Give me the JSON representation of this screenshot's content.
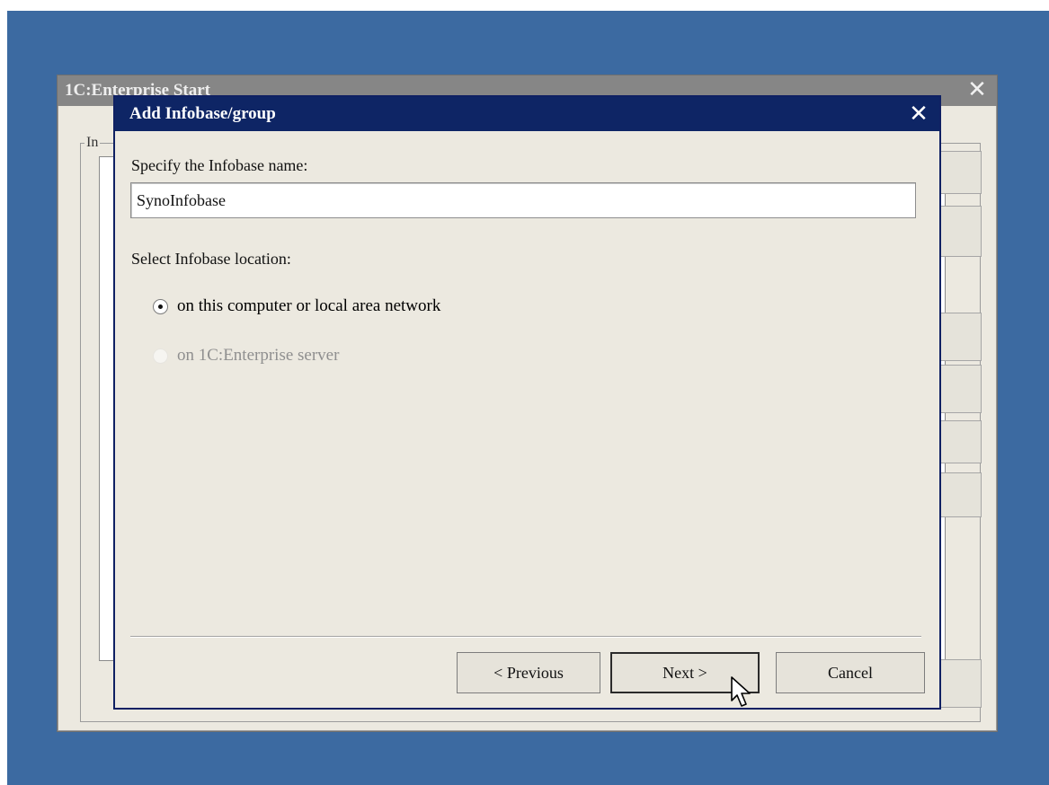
{
  "background_window": {
    "title": "1C:Enterprise Start",
    "group_legend": "In"
  },
  "dialog": {
    "title": "Add Infobase/group",
    "name_label": "Specify the Infobase name:",
    "name_value": "SynoInfobase",
    "location_label": "Select Infobase location:",
    "options": [
      {
        "label": "on this computer or local area network",
        "checked": true,
        "disabled": false
      },
      {
        "label": "on 1C:Enterprise server",
        "checked": false,
        "disabled": true
      }
    ],
    "buttons": {
      "previous": "< Previous",
      "next": "Next >",
      "cancel": "Cancel"
    }
  },
  "colors": {
    "desktop": "#3c6aa1",
    "titlebar_active": "#0e2565",
    "titlebar_inactive": "#868686",
    "dialog_bg": "#ece9e0"
  },
  "icons": {
    "close": "close-icon",
    "cursor": "mouse-pointer-icon"
  }
}
